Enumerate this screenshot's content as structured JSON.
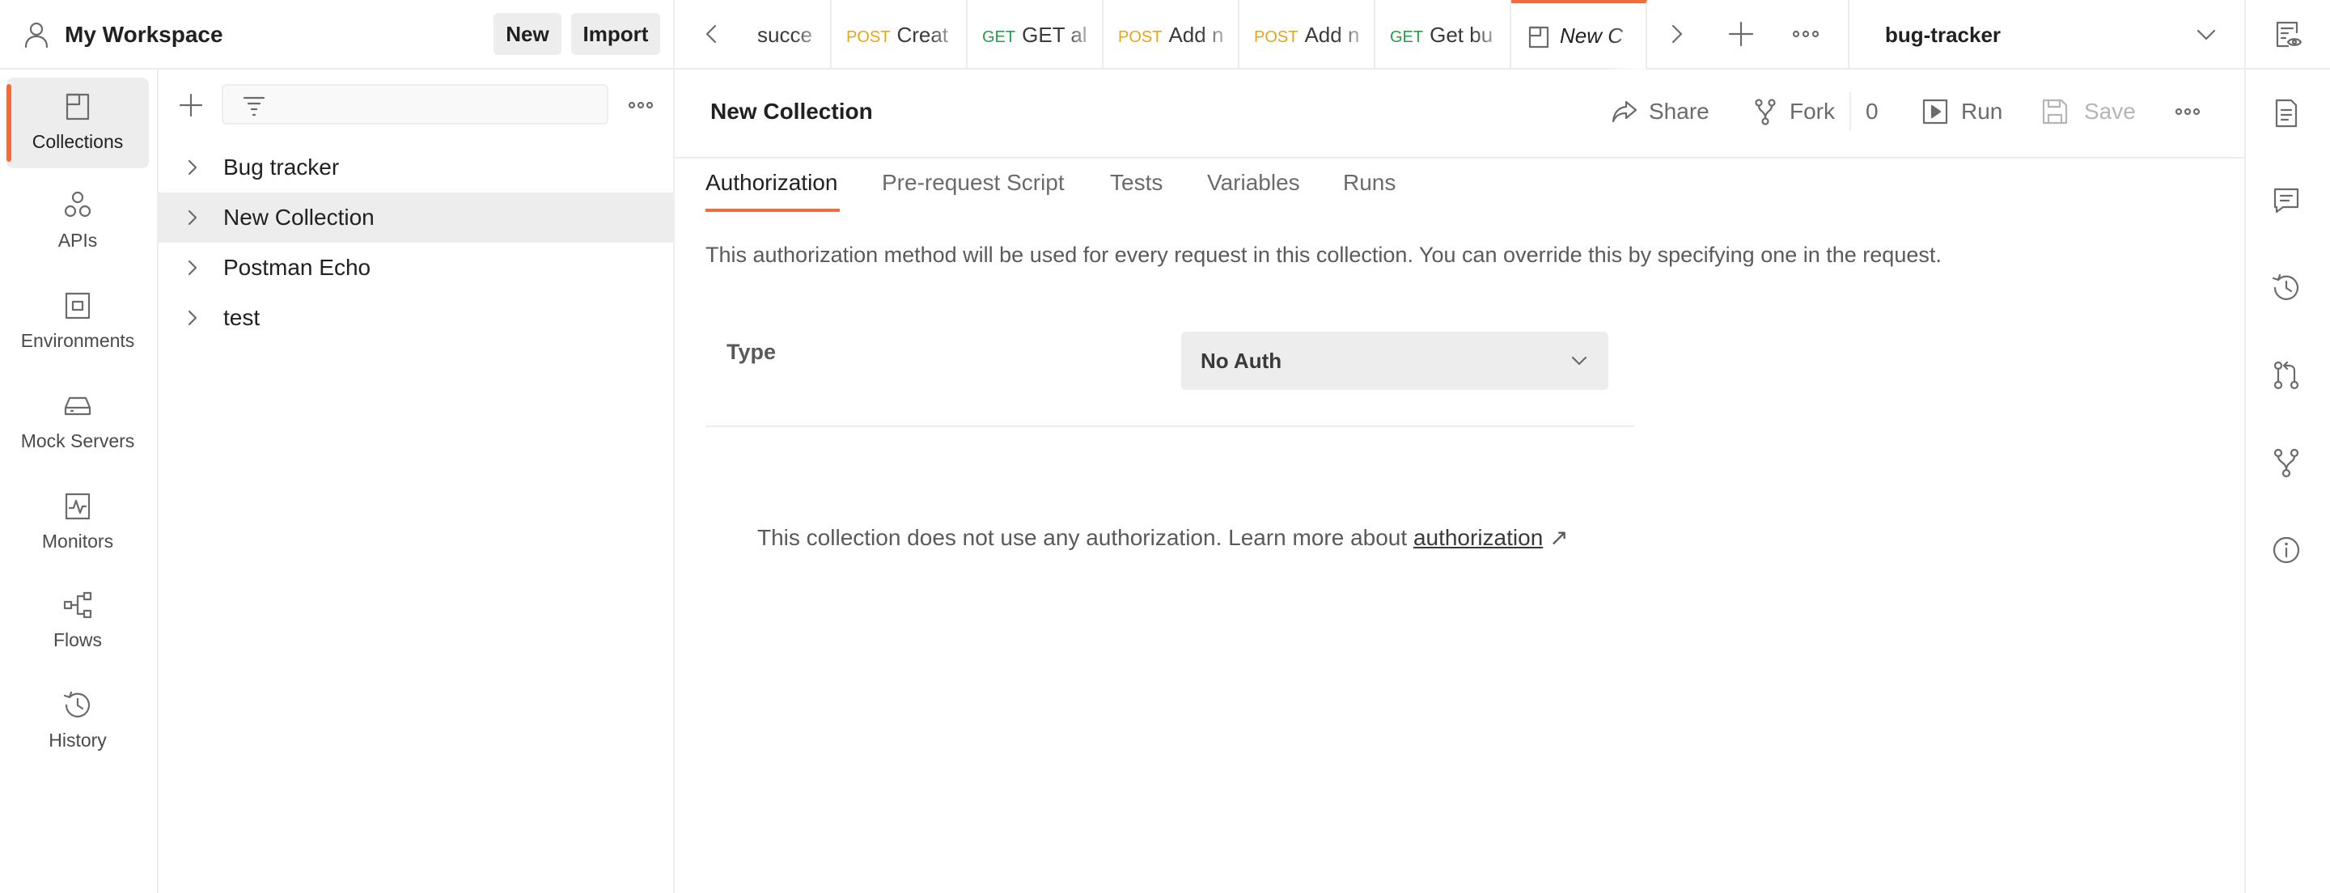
{
  "workspace": {
    "title": "My Workspace",
    "new_label": "New",
    "import_label": "Import"
  },
  "tabs": [
    {
      "method": "",
      "name": "succe"
    },
    {
      "method": "POST",
      "name": "Creat"
    },
    {
      "method": "GET",
      "name": "GET al"
    },
    {
      "method": "POST",
      "name": "Add n"
    },
    {
      "method": "POST",
      "name": "Add n"
    },
    {
      "method": "GET",
      "name": "Get bu"
    },
    {
      "method": "",
      "name": "New C"
    }
  ],
  "environment": {
    "selected": "bug-tracker"
  },
  "nav": [
    {
      "label": "Collections",
      "icon": "collections-icon"
    },
    {
      "label": "APIs",
      "icon": "apis-icon"
    },
    {
      "label": "Environments",
      "icon": "environments-icon"
    },
    {
      "label": "Mock Servers",
      "icon": "mock-servers-icon"
    },
    {
      "label": "Monitors",
      "icon": "monitors-icon"
    },
    {
      "label": "Flows",
      "icon": "flows-icon"
    },
    {
      "label": "History",
      "icon": "history-icon"
    }
  ],
  "sidebar": {
    "filter_placeholder": "",
    "collections": [
      {
        "name": "Bug tracker"
      },
      {
        "name": "New Collection"
      },
      {
        "name": "Postman Echo"
      },
      {
        "name": "test"
      }
    ]
  },
  "main": {
    "title": "New Collection",
    "actions": {
      "share": "Share",
      "fork": "Fork",
      "fork_count": "0",
      "run": "Run",
      "save": "Save"
    },
    "subtabs": [
      "Authorization",
      "Pre-request Script",
      "Tests",
      "Variables",
      "Runs"
    ],
    "auth": {
      "description": "This authorization method will be used for every request in this collection. You can override this by specifying one in the request.",
      "type_label": "Type",
      "type_value": "No Auth",
      "no_auth_message": "This collection does not use any authorization. Learn more about ",
      "link_text": "authorization",
      "link_arrow": "↗"
    }
  },
  "colors": {
    "accent": "#f26b3a",
    "post": "#e8a41b",
    "get": "#2a9d4b"
  },
  "right_bar_icons": [
    "documentation-icon",
    "comments-icon",
    "changelog-icon",
    "pull-requests-icon",
    "forks-icon",
    "info-icon"
  ]
}
